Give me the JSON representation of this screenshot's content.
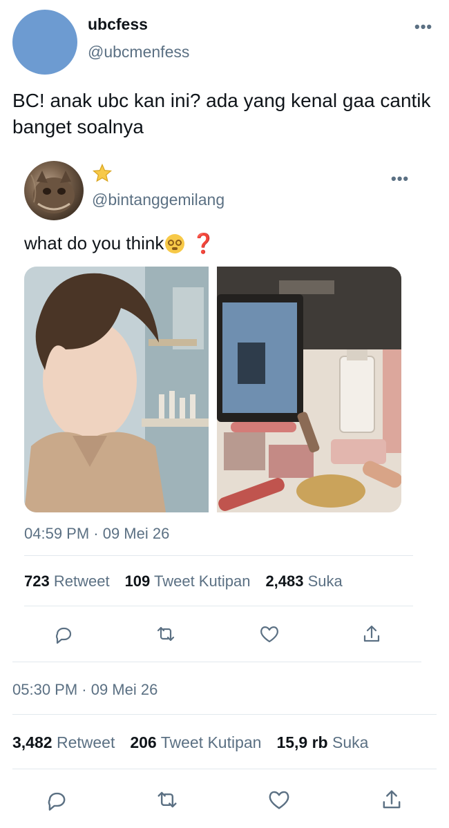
{
  "tweet": {
    "display_name": "ubcfess",
    "handle": "@ubcmenfess",
    "more": "•••",
    "text": "BC! anak ubc kan ini? ada yang kenal gaa cantik banget soalnya",
    "timestamp": "05:30 PM · 09 Mei 26",
    "stats": {
      "retweets": "3,482",
      "retweets_label": "Retweet",
      "quotes": "206",
      "quotes_label": "Tweet Kutipan",
      "likes": "15,9 rb",
      "likes_label": "Suka"
    }
  },
  "quoted_tweet": {
    "display_name_emoji": "star",
    "handle": "@bintanggemilang",
    "more": "•••",
    "text": "what do you think",
    "text_suffix": "❓",
    "timestamp": "04:59 PM · 09 Mei 26",
    "stats": {
      "retweets": "723",
      "retweets_label": "Retweet",
      "quotes": "109",
      "quotes_label": "Tweet Kutipan",
      "likes": "2,483",
      "likes_label": "Suka"
    },
    "images": [
      "selfie-photo",
      "makeup-flatlay-photo"
    ]
  },
  "icons": [
    "reply-icon",
    "retweet-icon",
    "like-icon",
    "share-icon"
  ],
  "colors": {
    "avatar_main": "#6d9bd1",
    "secondary_text": "#5b7083",
    "primary_text": "#0f1419",
    "divider": "#e1e8ed"
  }
}
